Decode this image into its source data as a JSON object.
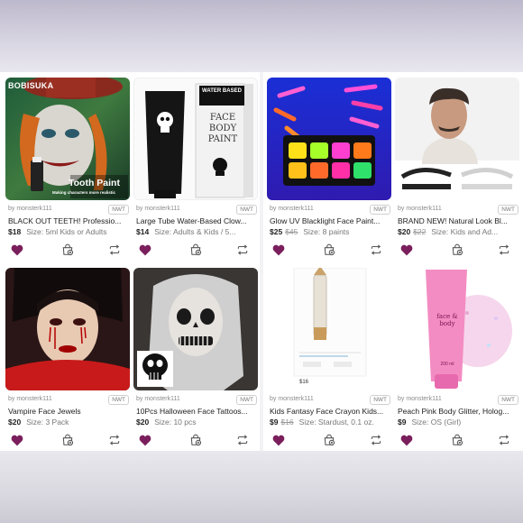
{
  "colors": {
    "heart": "#7a1f5c",
    "icon": "#555555"
  },
  "icons": {
    "like": "heart-icon",
    "bundle": "bag-plus-icon",
    "share": "repeat-icon"
  },
  "listings": [
    {
      "seller": "by monsterk111",
      "condition": "NWT",
      "title": "BLACK OUT TEETH! Professio...",
      "price": "$18",
      "original_price": "",
      "size": "Size: 5ml Kids or Adults",
      "image": {
        "brand_text": "BOBISUKA",
        "headline": "Tooth Paint",
        "subline": "Making characters more realistic"
      }
    },
    {
      "seller": "by monsterk111",
      "condition": "NWT",
      "title": "Large Tube Water-Based Clow...",
      "price": "$14",
      "original_price": "",
      "size": "Size: Adults & Kids / 5...",
      "image": {
        "box_text": "WATER BASED",
        "big_text": "FACE BODY PAINT"
      }
    },
    {
      "seller": "by monsterk111",
      "condition": "NWT",
      "title": "Glow UV Blacklight Face Paint...",
      "price": "$25",
      "original_price": "$45",
      "size": "Size: 8 paints",
      "image": {}
    },
    {
      "seller": "by monsterk111",
      "condition": "NWT",
      "title": "BRAND NEW! Natural Look Bl...",
      "price": "$20",
      "original_price": "$22",
      "size": "Size: Kids and Ad...",
      "image": {}
    },
    {
      "seller": "by monsterk111",
      "condition": "NWT",
      "title": "Vampire Face Jewels",
      "price": "$20",
      "original_price": "",
      "size": "Size: 3 Pack",
      "image": {}
    },
    {
      "seller": "by monsterk111",
      "condition": "NWT",
      "title": "10Pcs Halloween Face Tattoos...",
      "price": "$20",
      "original_price": "",
      "size": "Size: 10 pcs",
      "image": {}
    },
    {
      "seller": "by monsterk111",
      "condition": "NWT",
      "title": "Kids Fantasy Face Crayon Kids...",
      "price": "$9",
      "original_price": "$16",
      "size": "Size: Stardust, 0.1 oz.",
      "image": {
        "price_text": "$16"
      }
    },
    {
      "seller": "by monsterk111",
      "condition": "NWT",
      "title": "Peach Pink Body Glitter, Holog...",
      "price": "$9",
      "original_price": "",
      "size": "Size: OS (Girl)",
      "image": {
        "tube_text": "face & body",
        "ml_text": "200 ml"
      }
    }
  ]
}
